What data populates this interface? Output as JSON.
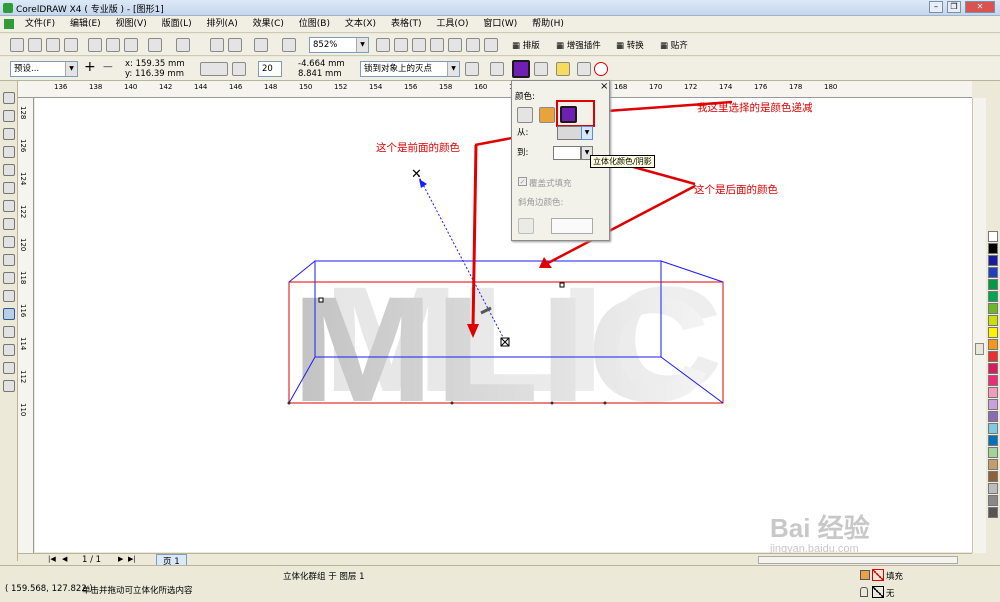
{
  "window": {
    "title": "CorelDRAW X4 ( 专业版 ) - [图形1]"
  },
  "menu": [
    "文件(F)",
    "编辑(E)",
    "视图(V)",
    "版面(L)",
    "排列(A)",
    "效果(C)",
    "位图(B)",
    "文本(X)",
    "表格(T)",
    "工具(O)",
    "窗口(W)",
    "帮助(H)"
  ],
  "toolbar": {
    "zoom": "852%",
    "tabs": [
      "排版",
      "增强插件",
      "转换",
      "贴齐"
    ]
  },
  "propbar": {
    "preset": "预设...",
    "x": "x: 159.35 mm",
    "y": "y: 116.39 mm",
    "depth": "20",
    "vx": "-4.664 mm",
    "vy": "8.841 mm",
    "vanish": "锁到对象上的灭点"
  },
  "ruler_top": [
    "136",
    "138",
    "140",
    "142",
    "144",
    "146",
    "148",
    "150",
    "152",
    "154",
    "156",
    "158",
    "160",
    "162",
    "164",
    "166",
    "168",
    "170",
    "172",
    "174",
    "176",
    "178",
    "180"
  ],
  "ruler_left": [
    "128",
    "126",
    "124",
    "122",
    "120",
    "118",
    "116",
    "114",
    "112",
    "110"
  ],
  "popup": {
    "color_label": "颜色:",
    "from_label": "从:",
    "to_label": "到:",
    "tooltip": "立体化颜色/阴影",
    "overlay": "覆盖式填充",
    "bevel": "斜角边颜色:"
  },
  "canvas": {
    "logo_text": "MLIC"
  },
  "annotations": {
    "gradient": "我这里选择的是颜色递减",
    "front": "这个是前面的颜色",
    "back": "这个是后面的颜色"
  },
  "pagebar": {
    "counter": "1 / 1",
    "tab": "页 1"
  },
  "status": {
    "object": "立体化群组 于 图层 1",
    "coords": "( 159.568, 127.822 )",
    "hint": "单击并拖动可立体化所选内容",
    "fill_label": "填充",
    "outline_label": "无"
  },
  "watermark": {
    "brand": "Bai 经验",
    "url": "jingyan.baidu.com"
  },
  "colors": {
    "accent_red": "#e00000",
    "selection_blue": "#1a1aff"
  },
  "palette": [
    "#ffffff",
    "#000000",
    "#1a1aa0",
    "#1f3fbf",
    "#009a44",
    "#00a650",
    "#6ab82d",
    "#cce000",
    "#fff200",
    "#f7941d",
    "#e8312f",
    "#d81b60",
    "#ee2a7b",
    "#f49ac1",
    "#c9a0dc",
    "#8b6bb5",
    "#7ec8e3",
    "#0072bc",
    "#a3d39c",
    "#c69c6d",
    "#8c6239",
    "#bbbbbb",
    "#888888",
    "#555555"
  ]
}
